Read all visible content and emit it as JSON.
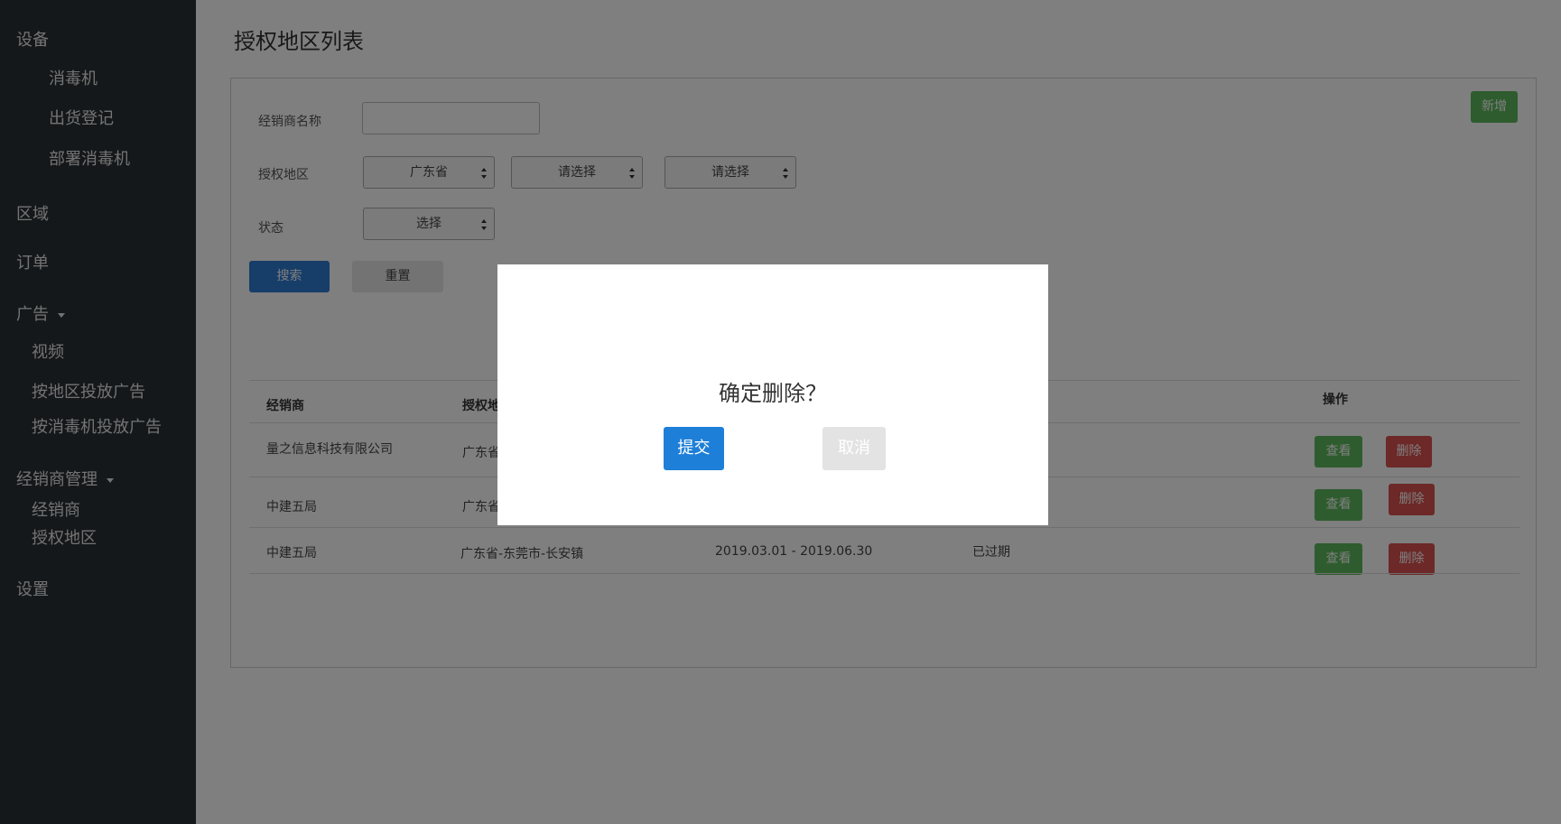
{
  "sidebar": {
    "devices": "设备",
    "disinfector": "消毒机",
    "shipment_register": "出货登记",
    "deploy_disinfector": "部署消毒机",
    "region": "区域",
    "orders": "订单",
    "ads": "广告",
    "video": "视频",
    "ads_by_region": "按地区投放广告",
    "ads_by_disinfector": "按消毒机投放广告",
    "dealer_management": "经销商管理",
    "dealers": "经销商",
    "authorized_regions": "授权地区",
    "settings": "设置"
  },
  "page": {
    "title": "授权地区列表",
    "add_button": "新增"
  },
  "filters": {
    "dealer_name_label": "经销商名称",
    "dealer_name_value": "",
    "region_label": "授权地区",
    "province": "广东省",
    "city": "请选择",
    "district": "请选择",
    "status_label": "状态",
    "status": "选择",
    "search_button": "搜索",
    "reset_button": "重置"
  },
  "table": {
    "headers": {
      "dealer": "经销商",
      "region": "授权地",
      "actions": "操作"
    },
    "rows": [
      {
        "dealer": "量之信息科技有限公司",
        "region": "广东省",
        "period": "",
        "status": "",
        "view": "查看",
        "delete": "删除"
      },
      {
        "dealer": "中建五局",
        "region": "广东省",
        "period": "",
        "status": "",
        "view": "查看",
        "delete": "删除"
      },
      {
        "dealer": "中建五局",
        "region": "广东省-东莞市-长安镇",
        "period": "2019.03.01 - 2019.06.30",
        "status": "已过期",
        "view": "查看",
        "delete": "删除"
      }
    ]
  },
  "modal": {
    "message": "确定删除？",
    "submit": "提交",
    "cancel": "取消"
  },
  "colors": {
    "sidebar_bg": "#2b3036",
    "primary": "#2f7bd2",
    "success": "#5cb85c",
    "danger": "#d9534f"
  }
}
